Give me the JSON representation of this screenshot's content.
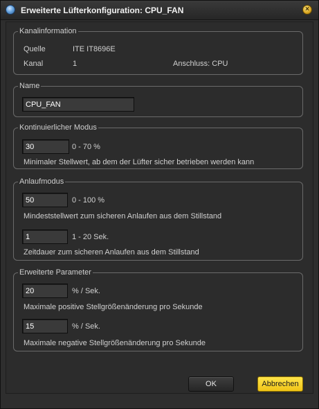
{
  "window": {
    "title": "Erweiterte Lüfterkonfiguration: CPU_FAN",
    "app_icon": "app-icon",
    "close_icon": "close-icon",
    "close_glyph": "×"
  },
  "kanalinformation": {
    "title": "Kanalinformation",
    "quelle_label": "Quelle",
    "quelle_value": "ITE IT8696E",
    "kanal_label": "Kanal",
    "kanal_value": "1",
    "anschluss": "Anschluss: CPU"
  },
  "name_group": {
    "title": "Name",
    "value": "CPU_FAN"
  },
  "kontinuierlich": {
    "title": "Kontinuierlicher Modus",
    "value": "30",
    "range": "0 - 70 %",
    "description": "Minimaler Stellwert, ab dem der Lüfter sicher betrieben werden kann"
  },
  "anlauf": {
    "title": "Anlaufmodus",
    "min_value": "50",
    "min_range": "0 - 100 %",
    "min_description": "Mindeststellwert zum sicheren Anlaufen aus dem Stillstand",
    "time_value": "1",
    "time_range": "1 - 20 Sek.",
    "time_description": "Zeitdauer zum sicheren Anlaufen aus dem Stillstand"
  },
  "erweitert": {
    "title": "Erweiterte Parameter",
    "pos_value": "20",
    "pos_unit": "% / Sek.",
    "pos_description": "Maximale positive Stellgrößenänderung pro Sekunde",
    "neg_value": "15",
    "neg_unit": "% / Sek.",
    "neg_description": "Maximale negative Stellgrößenänderung pro Sekunde"
  },
  "buttons": {
    "ok": "OK",
    "cancel": "Abbrechen"
  },
  "colors": {
    "accent": "#f0c417",
    "background": "#2c2c2c",
    "group_border": "#6b6b6b"
  }
}
